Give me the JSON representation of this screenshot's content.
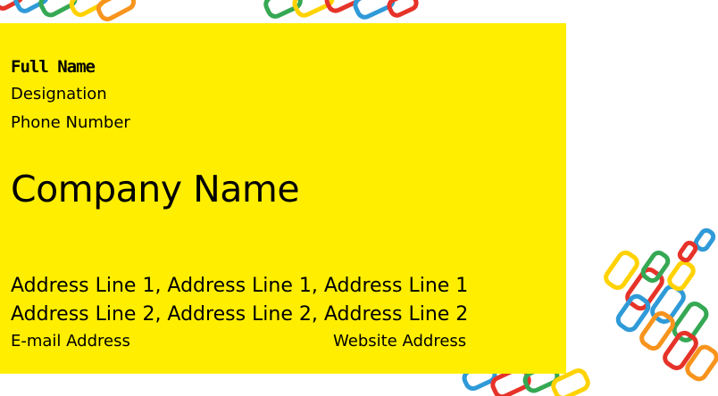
{
  "card": {
    "background_color": "#ffee00",
    "full_name": "Full Name",
    "designation": "Designation",
    "phone": "Phone Number",
    "company": "Company Name",
    "address_line_1": "Address Line 1,  Address Line 1,  Address Line 1",
    "address_line_2": "Address Line 2,  Address Line 2,  Address Line 2",
    "email": "E-mail Address",
    "website": "Website Address"
  },
  "decoration": {
    "colors": [
      "#e63329",
      "#2f9ad8",
      "#35a853",
      "#ffd200",
      "#f7941d"
    ]
  }
}
